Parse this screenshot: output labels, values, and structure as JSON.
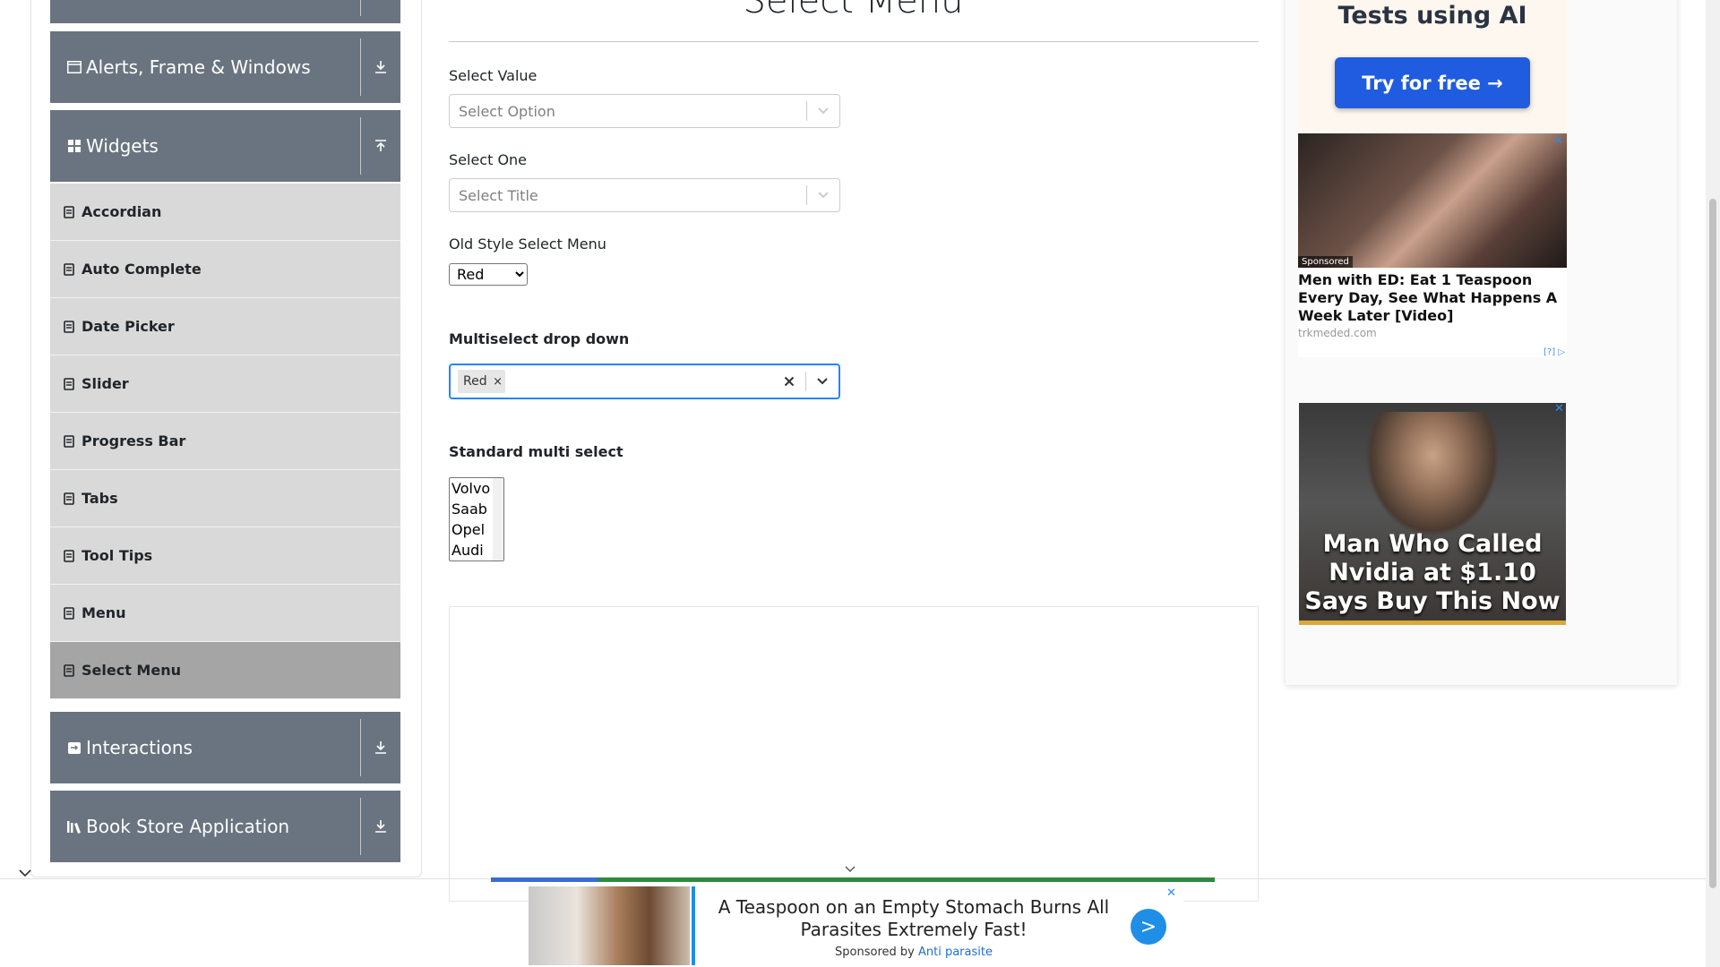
{
  "sidebar": {
    "groups": [
      {
        "title": "Alerts, Frame & Windows",
        "icon": "window-icon",
        "expanded": false
      },
      {
        "title": "Widgets",
        "icon": "widgets-grid-icon",
        "expanded": true
      },
      {
        "title": "Interactions",
        "icon": "interactions-icon",
        "expanded": false
      },
      {
        "title": "Book Store Application",
        "icon": "book-store-icon",
        "expanded": false
      }
    ],
    "items": [
      {
        "label": "Accordian",
        "active": false
      },
      {
        "label": "Auto Complete",
        "active": false
      },
      {
        "label": "Date Picker",
        "active": false
      },
      {
        "label": "Slider",
        "active": false
      },
      {
        "label": "Progress Bar",
        "active": false
      },
      {
        "label": "Tabs",
        "active": false
      },
      {
        "label": "Tool Tips",
        "active": false
      },
      {
        "label": "Menu",
        "active": false
      },
      {
        "label": "Select Menu",
        "active": true
      }
    ]
  },
  "main": {
    "title": "Select Menu",
    "select_value": {
      "label": "Select Value",
      "placeholder": "Select Option"
    },
    "select_one": {
      "label": "Select One",
      "placeholder": "Select Title"
    },
    "old_style": {
      "label": "Old Style Select Menu",
      "selected": "Red"
    },
    "multiselect": {
      "label": "Multiselect drop down",
      "tags": [
        "Red"
      ]
    },
    "standard_multi": {
      "label": "Standard multi select",
      "options": [
        "Volvo",
        "Saab",
        "Opel",
        "Audi"
      ]
    }
  },
  "ads": {
    "ad1": {
      "headline": "Tests using AI",
      "button": "Try for free →"
    },
    "ad2": {
      "sponsored": "Sponsored",
      "headline": "Men with ED: Eat 1 Teaspoon Every Day, See What Happens A Week Later [Video]",
      "domain": "trkmeded.com",
      "adchoices": "[?]",
      "close": "✕"
    },
    "ad3": {
      "headline": "Man Who Called Nvidia at $1.10 Says Buy This Now",
      "close": "✕"
    },
    "bottom": {
      "headline": "A Teaspoon on an Empty Stomach Burns All Parasites Extremely Fast!",
      "sponsored_prefix": "Sponsored by",
      "brand": "Anti parasite",
      "go": ">",
      "close": "✕"
    }
  },
  "colors": {
    "sidebar_header": "#6a7480",
    "menu_item": "#d9d9d9",
    "menu_item_active": "#a5a5a5",
    "focus": "#2684ff",
    "cta": "#1f5ce0"
  }
}
